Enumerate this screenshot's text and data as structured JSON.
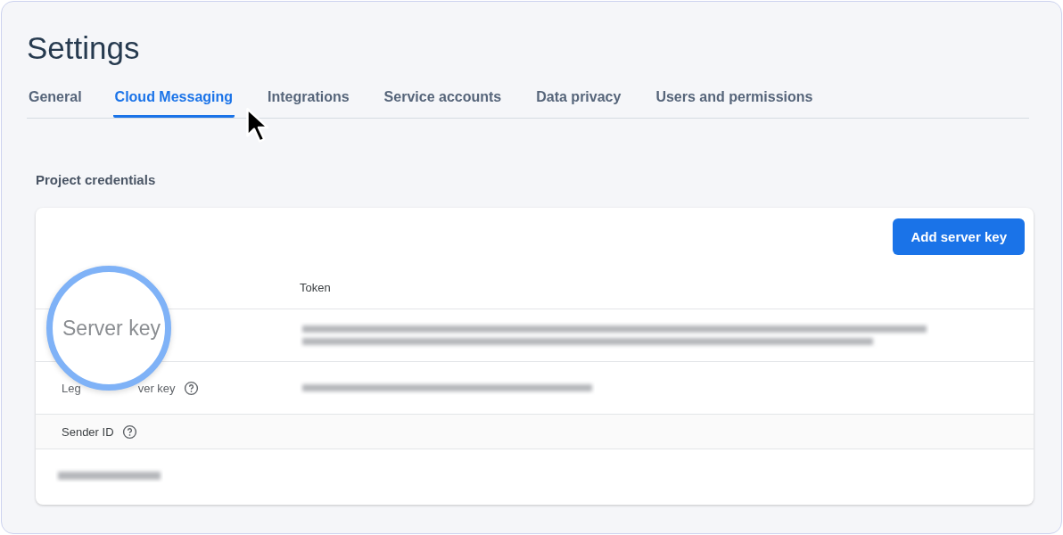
{
  "page": {
    "title": "Settings"
  },
  "tabs": [
    {
      "label": "General",
      "selected": false
    },
    {
      "label": "Cloud Messaging",
      "selected": true
    },
    {
      "label": "Integrations",
      "selected": false
    },
    {
      "label": "Service accounts",
      "selected": false
    },
    {
      "label": "Data privacy",
      "selected": false
    },
    {
      "label": "Users and permissions",
      "selected": false
    }
  ],
  "section_title": "Project credentials",
  "card": {
    "button": "Add server key",
    "columns": [
      "Token"
    ],
    "rows": [
      {
        "kind": "key",
        "label_parts": [],
        "help": false,
        "redacted": true
      },
      {
        "kind": "key",
        "label_parts": [
          "Leg",
          "ver key"
        ],
        "help": true,
        "redacted": true
      },
      {
        "kind": "heading",
        "label_parts": [
          "Sender ID"
        ],
        "help": true
      },
      {
        "kind": "value",
        "redacted": true
      }
    ]
  },
  "magnifier": {
    "text": "Server key"
  }
}
